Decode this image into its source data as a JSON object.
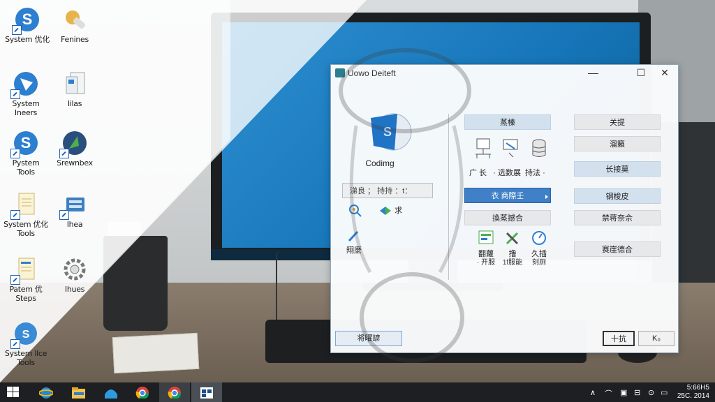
{
  "desktop": {
    "icons": [
      {
        "name": "system-optimizer-icon",
        "label": "System 优化"
      },
      {
        "name": "fonts-folder-icon",
        "label": "Fenines"
      },
      {
        "name": "system-inners-icon",
        "label": "System\nIneers"
      },
      {
        "name": "files-icon",
        "label": "Iilas"
      },
      {
        "name": "system-tools-icon",
        "label": "Pystem\nTools"
      },
      {
        "name": "browser-icon",
        "label": "Srewnbex"
      },
      {
        "name": "system-tools-2-icon",
        "label": "System 优化\nTools"
      },
      {
        "name": "network-icon",
        "label": "Ihea"
      },
      {
        "name": "system-steps-icon",
        "label": "Patem 优\nSteps"
      },
      {
        "name": "settings-gear-icon",
        "label": "Ihues"
      },
      {
        "name": "system-tools-3-icon",
        "label": "System llce\nTools"
      }
    ]
  },
  "window": {
    "title": "Uowo Deiteft",
    "controls": {
      "minimize": "—",
      "maximize": "☐",
      "close": "✕"
    },
    "app_name": "Codimg",
    "field_text": "涕良  ； 持持 ：t：",
    "left_items": [
      {
        "label": ""
      },
      {
        "label": "求"
      },
      {
        "label": "翔麼"
      }
    ],
    "middle": {
      "header1": "蒸榛",
      "row1_caption": "广 长   · 选数展  持法 ·",
      "selected": "衣 商際壬",
      "header2": "換蒸撼合",
      "row2": [
        {
          "label": "翻蘿",
          "sub": "· 开服"
        },
        {
          "label": "撸",
          "sub": "1f服能"
        },
        {
          "label": "久插",
          "sub": "刻厕"
        }
      ]
    },
    "right_buttons": [
      "关提",
      "溜籟",
      "长接莫",
      "钢梭皮",
      "禁蒋奈佘",
      "赛崖德合"
    ],
    "bottom_left": "将曜諺",
    "bottom_ok": "十抗",
    "bottom_cancel": "K₀"
  },
  "taskbar": {
    "items": [
      "start",
      "internet-explorer",
      "file-explorer",
      "store",
      "chrome",
      "chrome-2",
      "app-window"
    ],
    "tray": [
      "∧",
      "⌒",
      "▣",
      "⊟",
      "⊙",
      "▭"
    ],
    "clock_time": "5:66H5",
    "clock_date": "25C. 2014"
  }
}
